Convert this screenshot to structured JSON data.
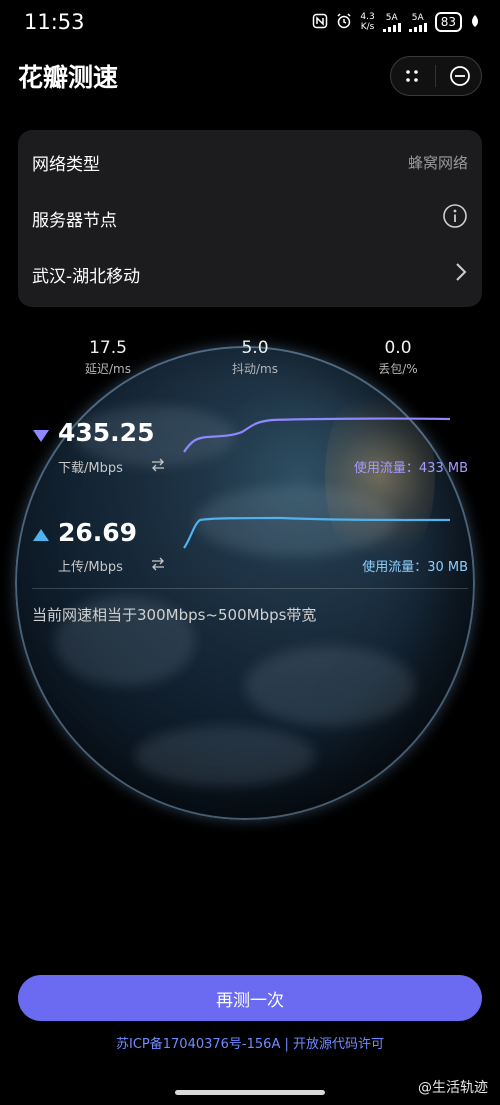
{
  "status_bar": {
    "time": "11:53",
    "net_speed_top": "4.3",
    "net_speed_bottom": "K/s",
    "sim1": "5A",
    "sim2": "5A",
    "battery": "83"
  },
  "header": {
    "title": "花瓣测速"
  },
  "info_card": {
    "network_type_label": "网络类型",
    "network_type_value": "蜂窝网络",
    "server_node_label": "服务器节点",
    "server_location": "武汉-湖北移动"
  },
  "metrics": {
    "latency": {
      "value": "17.5",
      "label": "延迟/ms"
    },
    "jitter": {
      "value": "5.0",
      "label": "抖动/ms"
    },
    "loss": {
      "value": "0.0",
      "label": "丢包/%"
    }
  },
  "download": {
    "speed": "435.25",
    "unit_label": "下载/Mbps",
    "usage": "使用流量：433 MB",
    "color": "#8f87ff"
  },
  "upload": {
    "speed": "26.69",
    "unit_label": "上传/Mbps",
    "usage": "使用流量：30 MB",
    "color": "#4fb3f0"
  },
  "bandwidth_note": "当前网速相当于300Mbps~500Mbps带宽",
  "retest_button": "再测一次",
  "icp_text": "苏ICP备17040376号-156A | 开放源代码许可",
  "watermark": "@生活轨迹",
  "colors": {
    "accent": "#6a6bf0",
    "card_bg": "#1c1c1e",
    "link": "#6f8cff"
  }
}
